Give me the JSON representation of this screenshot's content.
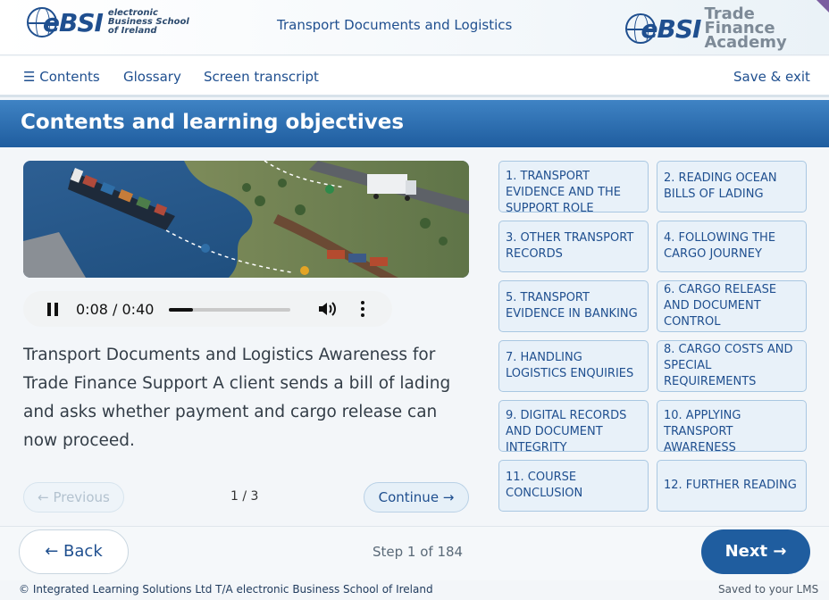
{
  "header": {
    "left_logo_brand": "eBSI",
    "left_logo_lines": [
      "electronic",
      "Business School",
      "of Ireland"
    ],
    "title": "Transport Documents and Logistics",
    "right_logo_brand": "eBSI",
    "right_logo_lines": [
      "Trade Finance",
      "Academy"
    ]
  },
  "nav": {
    "contents": "☰ Contents",
    "glossary": "Glossary",
    "transcript": "Screen transcript",
    "save_exit": "Save & exit"
  },
  "banner": {
    "title": "Contents and learning objectives"
  },
  "audio": {
    "time": "0:08 / 0:40",
    "progress": 0.2
  },
  "body": {
    "text": "Transport Documents and Logistics Awareness for Trade Finance Support A client sends a bill of lading and asks whether payment and cargo release can now proceed."
  },
  "pager": {
    "previous": "← Previous",
    "page": "1 / 3",
    "continue": "Continue →"
  },
  "topics": [
    {
      "label": "1. TRANSPORT EVIDENCE AND THE SUPPORT ROLE"
    },
    {
      "label": "2. READING OCEAN BILLS OF LADING"
    },
    {
      "label": "3. OTHER TRANSPORT RECORDS"
    },
    {
      "label": "4. FOLLOWING THE CARGO JOURNEY"
    },
    {
      "label": "5. TRANSPORT EVIDENCE IN BANKING"
    },
    {
      "label": "6. CARGO RELEASE AND DOCUMENT CONTROL"
    },
    {
      "label": "7. HANDLING LOGISTICS ENQUIRIES"
    },
    {
      "label": "8. CARGO COSTS AND SPECIAL REQUIREMENTS"
    },
    {
      "label": "9. DIGITAL RECORDS AND DOCUMENT INTEGRITY"
    },
    {
      "label": "10. APPLYING TRANSPORT AWARENESS"
    },
    {
      "label": "11. COURSE CONCLUSION"
    },
    {
      "label": "12. FURTHER READING"
    }
  ],
  "footer": {
    "back": "← Back",
    "step": "Step 1 of 184",
    "next": "Next →",
    "copyright": "© Integrated Learning Solutions Ltd T/A electronic Business School of Ireland",
    "saved": "Saved to your LMS"
  },
  "colors": {
    "primary": "#1f5d9f",
    "banner_top": "#3f83c4",
    "accent_text": "#1f4f8f"
  }
}
